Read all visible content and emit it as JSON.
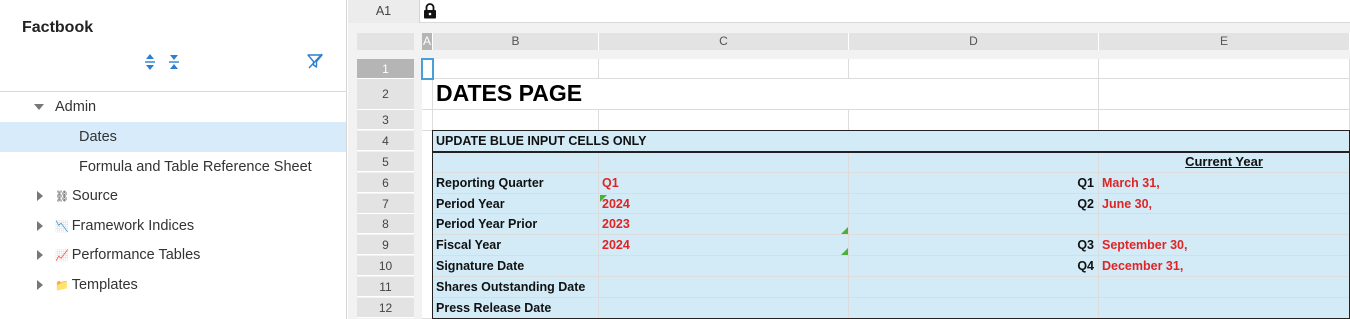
{
  "sidebar": {
    "title": "Factbook",
    "items": [
      {
        "label": "Admin",
        "expanded": true,
        "icon": ""
      },
      {
        "label": "Dates",
        "selected": true
      },
      {
        "label": "Formula and Table Reference Sheet"
      },
      {
        "label": "Source",
        "icon": "⛓"
      },
      {
        "label": "Framework Indices",
        "icon": "📉"
      },
      {
        "label": "Performance Tables",
        "icon": "📈"
      },
      {
        "label": "Templates",
        "icon": "📁"
      }
    ]
  },
  "formula_bar": {
    "cell_ref": "A1"
  },
  "columns": [
    "A",
    "B",
    "C",
    "D",
    "E"
  ],
  "rows": [
    "1",
    "2",
    "3",
    "4",
    "5",
    "6",
    "7",
    "8",
    "9",
    "10",
    "11",
    "12"
  ],
  "sheet": {
    "title": "DATES PAGE",
    "instruction": "UPDATE BLUE INPUT CELLS ONLY",
    "current_year_header": "Current Year",
    "labels": {
      "reporting_quarter": "Reporting Quarter",
      "period_year": "Period Year",
      "period_year_prior": "Period Year Prior",
      "fiscal_year": "Fiscal Year",
      "signature_date": "Signature Date",
      "shares_outstanding_date": "Shares Outstanding Date",
      "press_release_date": "Press Release Date"
    },
    "values": {
      "reporting_quarter": "Q1",
      "period_year": "2024",
      "period_year_prior": "2023",
      "fiscal_year": "2024"
    },
    "quarters": [
      {
        "q": "Q1",
        "date": "March 31,"
      },
      {
        "q": "Q2",
        "date": "June 30,"
      },
      {
        "q": "Q3",
        "date": "September 30,"
      },
      {
        "q": "Q4",
        "date": "December 31,"
      }
    ]
  },
  "colors": {
    "input_blue": "#d2ebf7",
    "value_red": "#e02424",
    "selected_row": "#d7ebfa",
    "accent": "#4a9fd8"
  }
}
